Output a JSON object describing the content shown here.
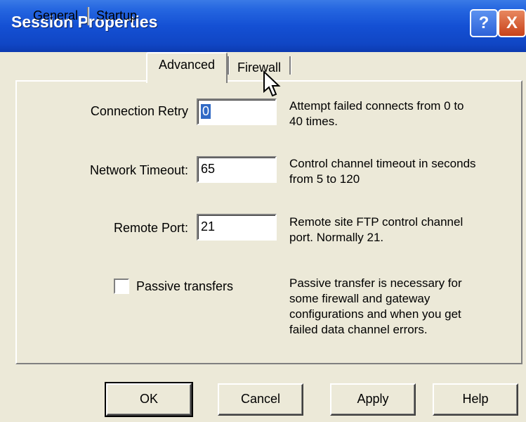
{
  "window": {
    "title": "Session Properties"
  },
  "titlebar": {
    "help_label": "?",
    "close_label": "X"
  },
  "tabs": [
    "General",
    "Startup",
    "Advanced",
    "Firewall"
  ],
  "active_tab": "Advanced",
  "settings": {
    "connection_retry": {
      "label": "Connection Retry",
      "value": "0",
      "description_line1": "Attempt failed connects from 0 to",
      "description_line2": "40 times."
    },
    "network_timeout": {
      "label": "Network Timeout:",
      "value": "65",
      "description_line1": "Control channel timeout in seconds",
      "description_line2": "from 5 to 120"
    },
    "remote_port": {
      "label": "Remote Port:",
      "value": "21",
      "description_line1": "Remote site FTP control channel",
      "description_line2": "port. Normally 21."
    },
    "passive": {
      "label": "Passive transfers",
      "checked": false,
      "description_line1": "Passive transfer is necessary for",
      "description_line2": "some firewall and gateway",
      "description_line3": "configurations and when you get",
      "description_line4": "failed data channel errors."
    }
  },
  "buttons": {
    "ok": "OK",
    "cancel": "Cancel",
    "apply": "Apply",
    "help": "Help"
  },
  "colors": {
    "titlebar": "#1450d4",
    "face": "#ece9d8",
    "selection": "#316ac5"
  }
}
